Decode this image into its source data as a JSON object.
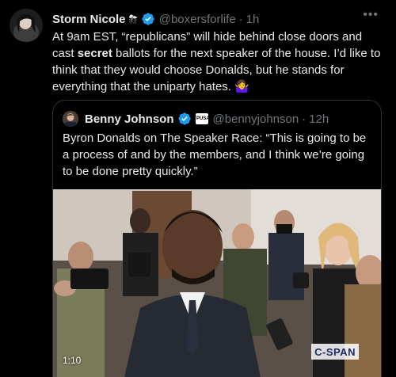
{
  "tweet": {
    "author_name": "Storm Nicole",
    "name_emoji": "⛈",
    "handle": "@boxersforlife",
    "separator": "·",
    "time": "1h",
    "more_label": "•••",
    "text_part1": "At 9am EST, “republicans” will hide behind close doors and cast ",
    "text_bold": "secret",
    "text_part2": " ballots for the next speaker of the house. I’d like to think that they would choose Donalds, but he stands for everything that the uniparty hates. ",
    "text_emoji": "🤷‍♀️"
  },
  "quoted": {
    "author_name": "Benny Johnson",
    "affiliate_label": "TPUSA",
    "handle": "@bennyjohnson",
    "separator": "·",
    "time": "12h",
    "text": "Byron Donalds on The Speaker Race: “This is going to be a process of and by the members, and I think we’re going to be done pretty quickly.”",
    "video": {
      "timecode": "1:10",
      "watermark": "C-SPAN"
    }
  },
  "colors": {
    "background": "#000000",
    "text": "#e7e9ea",
    "muted": "#71767b",
    "verified": "#1d9bf0",
    "border": "#2f3336"
  }
}
